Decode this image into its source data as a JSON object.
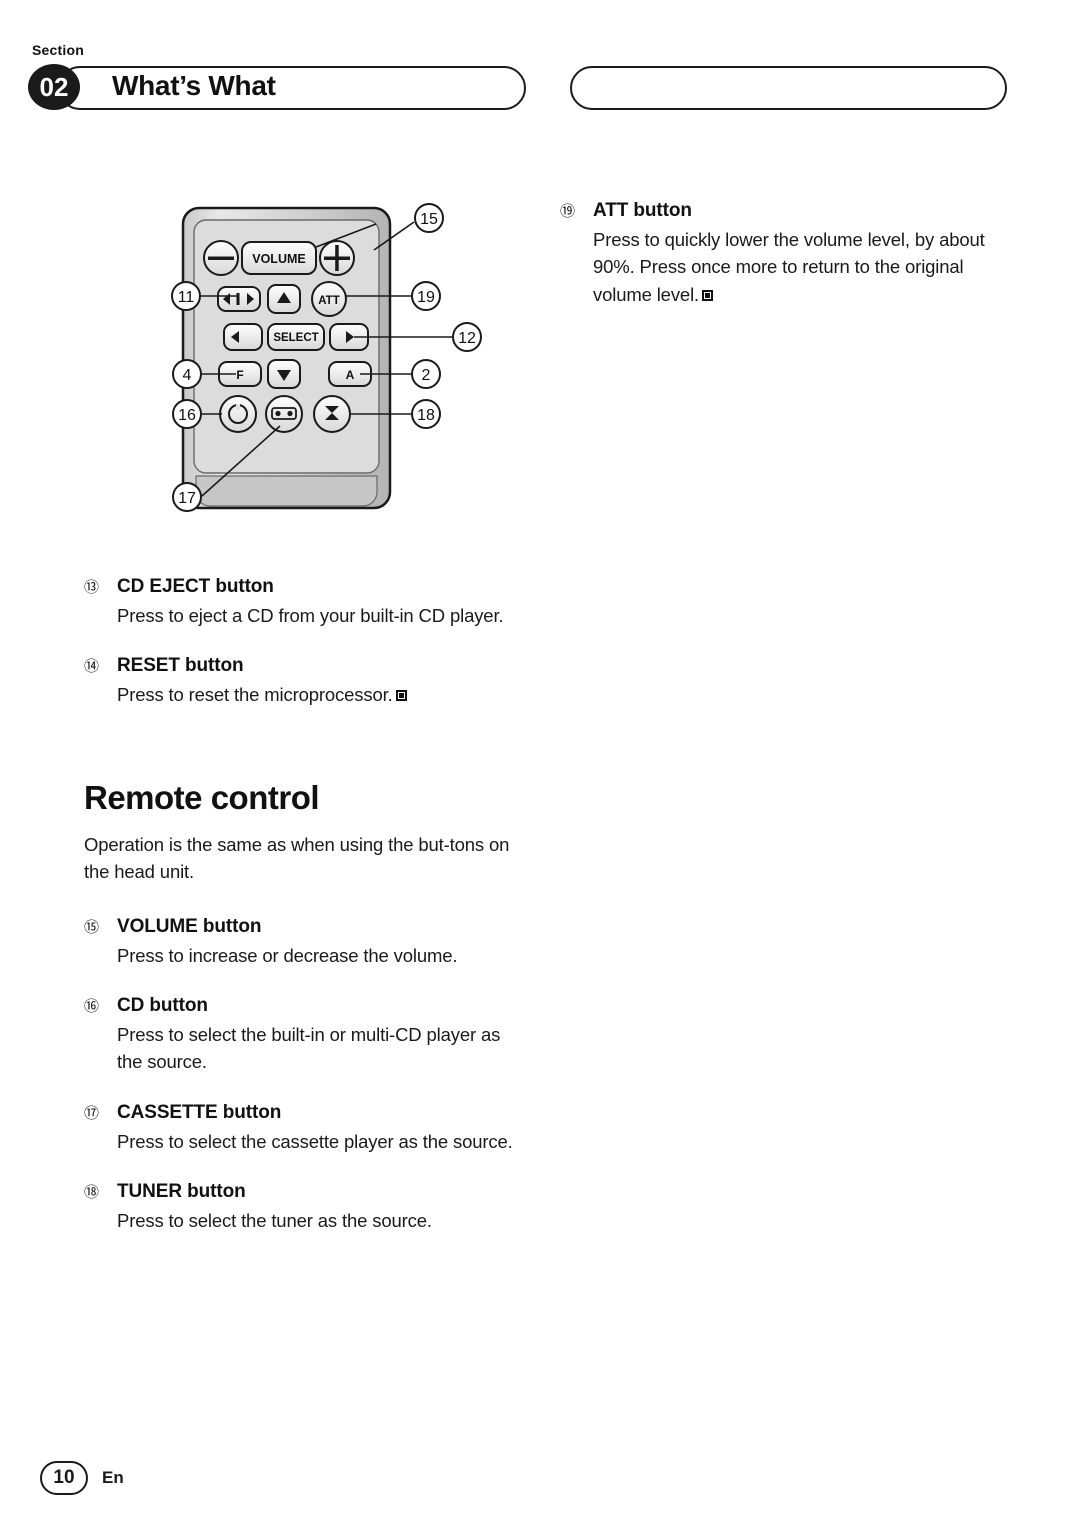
{
  "header": {
    "section_label": "Section",
    "section_number": "02",
    "title": "What’s What"
  },
  "diagram": {
    "name": "remote-control-diagram",
    "button_labels": {
      "volume": "VOLUME",
      "minus": "−",
      "plus": "+",
      "att": "ATT",
      "select": "SELECT",
      "function": "F",
      "audio": "A"
    },
    "callouts": [
      {
        "id": "15",
        "label": "⑮",
        "side": "right"
      },
      {
        "id": "11",
        "label": "⑪",
        "side": "left"
      },
      {
        "id": "19",
        "label": "⑲",
        "side": "right"
      },
      {
        "id": "12",
        "label": "⑫",
        "side": "right"
      },
      {
        "id": "4",
        "label": "④",
        "side": "left"
      },
      {
        "id": "2",
        "label": "②",
        "side": "right"
      },
      {
        "id": "16",
        "label": "⑯",
        "side": "left"
      },
      {
        "id": "18",
        "label": "⑱",
        "side": "right"
      },
      {
        "id": "17",
        "label": "⑰",
        "side": "left"
      }
    ]
  },
  "left_column": {
    "items": [
      {
        "num": "⑬",
        "title": "CD EJECT button",
        "body": "Press to eject a CD from your built-in CD player.",
        "end_square": false
      },
      {
        "num": "⑭",
        "title": "RESET button",
        "body": "Press to reset the microprocessor.",
        "end_square": true
      }
    ],
    "section_title": "Remote control",
    "intro": "Operation is the same as when using the but-tons on the head unit.",
    "items2": [
      {
        "num": "⑮",
        "title": "VOLUME button",
        "body": "Press to increase or decrease the volume.",
        "end_square": false
      },
      {
        "num": "⑯",
        "title": "CD button",
        "body": "Press to select the built-in or multi-CD player as the source.",
        "end_square": false
      },
      {
        "num": "⑰",
        "title": "CASSETTE button",
        "body": "Press to select the cassette player as the source.",
        "end_square": false
      },
      {
        "num": "⑱",
        "title": "TUNER button",
        "body": "Press to select the tuner as the source.",
        "end_square": false
      }
    ]
  },
  "right_column": {
    "items": [
      {
        "num": "⑲",
        "title": "ATT button",
        "body": "Press to quickly lower the volume level, by about 90%. Press once more to return to the original volume level.",
        "end_square": true
      }
    ]
  },
  "footer": {
    "page": "10",
    "language": "En"
  },
  "colors": {
    "ink": "#1a1a1a",
    "remote_body": "#d4d4d4",
    "remote_key": "#ffffff"
  }
}
